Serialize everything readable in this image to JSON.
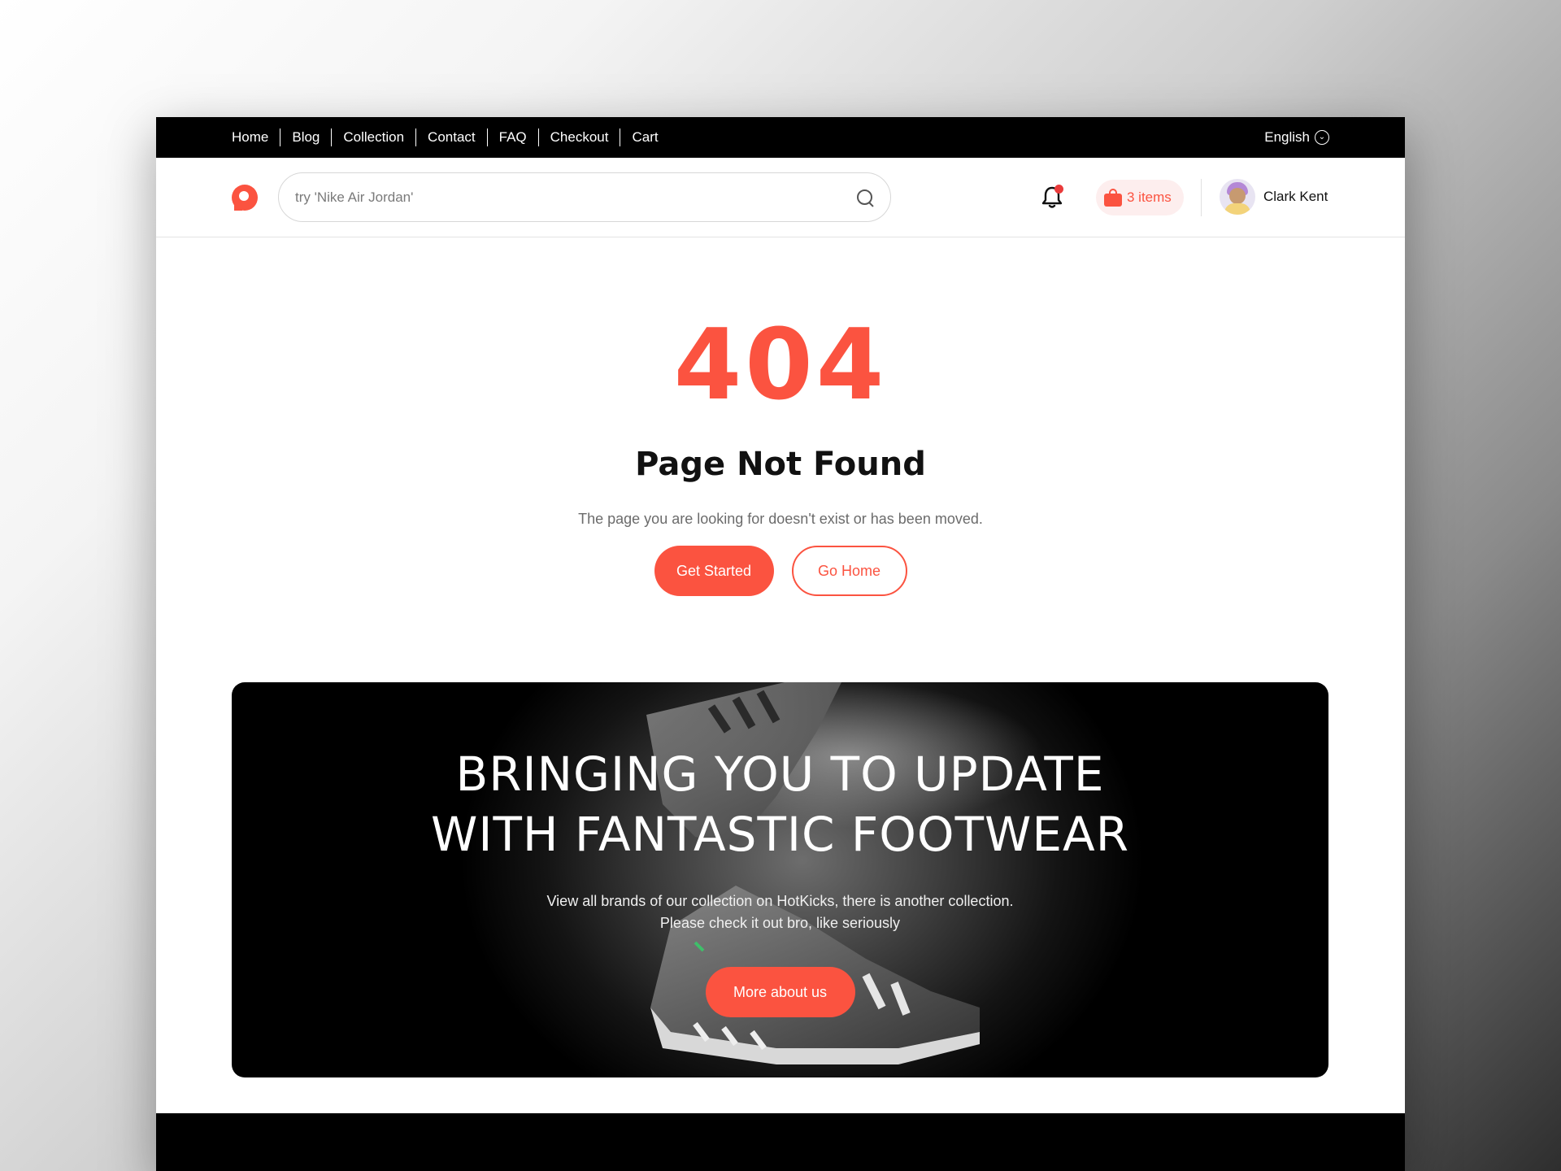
{
  "topnav": {
    "links": [
      "Home",
      "Blog",
      "Collection",
      "Contact",
      "FAQ",
      "Checkout",
      "Cart"
    ],
    "language": "English"
  },
  "header": {
    "search_placeholder": "try 'Nike Air Jordan'",
    "cart_label": "3 items",
    "user_name": "Clark Kent"
  },
  "error": {
    "code": "404",
    "title": "Page Not Found",
    "message": "The page you are looking for doesn't exist or has been moved.",
    "primary_button": "Get Started",
    "secondary_button": "Go Home"
  },
  "banner": {
    "title_line1": "BRINGING YOU TO UPDATE",
    "title_line2": "WITH FANTASTIC FOOTWEAR",
    "text_line1": "View all brands of our collection on HotKicks, there is another collection.",
    "text_line2": "Please check it out bro, like seriously",
    "button": "More about us"
  },
  "colors": {
    "accent": "#fb5340",
    "notification_dot": "#ea3b3b",
    "nav_background": "#000000"
  },
  "icons": [
    "logo-icon",
    "search-icon",
    "bell-icon",
    "shopping-bag-icon",
    "chevron-down-icon",
    "avatar"
  ]
}
